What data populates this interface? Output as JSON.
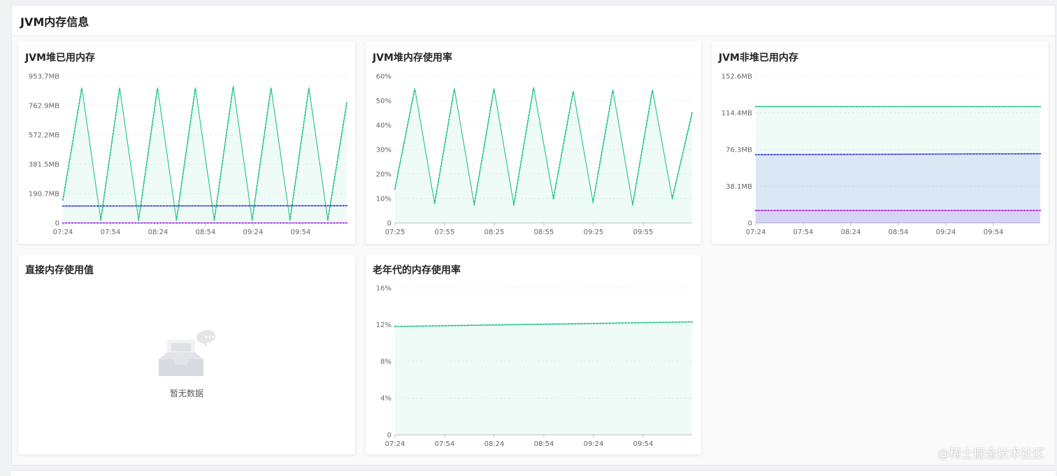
{
  "section": {
    "title": "JVM内存信息"
  },
  "colors": {
    "green": "#1fc486",
    "blue": "#3b3ce8",
    "purple": "#a92ee8"
  },
  "cards": {
    "heap_used": {
      "title": "JVM堆已用内存",
      "chart_data": {
        "type": "line",
        "ytick_labels": [
          "0",
          "190.7MB",
          "381.5MB",
          "572.2MB",
          "762.9MB",
          "953.7MB"
        ],
        "ylim": [
          0,
          953.7
        ],
        "xtick_labels": [
          "07:24",
          "07:54",
          "08:24",
          "08:54",
          "09:24",
          "09:54"
        ],
        "series": [
          {
            "color": "green",
            "area": true,
            "values": [
              150,
              880,
              20,
              880,
              20,
              880,
              20,
              880,
              20,
              890,
              20,
              880,
              20,
              880,
              20,
              780
            ]
          },
          {
            "color": "blue",
            "values": [
              110,
              112
            ]
          },
          {
            "color": "purple",
            "values": [
              0,
              0
            ]
          }
        ]
      }
    },
    "heap_usage_rate": {
      "title": "JVM堆内存使用率",
      "chart_data": {
        "type": "line",
        "ytick_labels": [
          "0",
          "10%",
          "20%",
          "30%",
          "40%",
          "50%",
          "60%"
        ],
        "ylim": [
          0,
          60
        ],
        "xtick_labels": [
          "07:25",
          "07:55",
          "08:25",
          "08:55",
          "09:25",
          "09:55"
        ],
        "series": [
          {
            "color": "green",
            "area": true,
            "values": [
              14,
              55,
              8,
              55,
              7.5,
              55,
              7.5,
              55.5,
              10,
              54,
              8.5,
              54.5,
              7.5,
              54.5,
              10,
              45
            ]
          }
        ]
      }
    },
    "nonheap_used": {
      "title": "JVM非堆已用内存",
      "chart_data": {
        "type": "line",
        "ytick_labels": [
          "0",
          "38.1MB",
          "76.3MB",
          "114.4MB",
          "152.6MB"
        ],
        "ylim": [
          0,
          152.6
        ],
        "xtick_labels": [
          "07:24",
          "07:54",
          "08:24",
          "08:54",
          "09:24",
          "09:54"
        ],
        "series": [
          {
            "color": "green",
            "area": true,
            "values": [
              121,
              121
            ]
          },
          {
            "color": "blue",
            "area": true,
            "values": [
              71,
              72
            ]
          },
          {
            "color": "purple",
            "area": true,
            "values": [
              13,
              13
            ]
          }
        ]
      }
    },
    "direct_memory": {
      "title": "直接内存使用值",
      "empty_text": "暂无数据"
    },
    "old_gen_rate": {
      "title": "老年代的内存使用率",
      "chart_data": {
        "type": "line",
        "ytick_labels": [
          "0",
          "4%",
          "8%",
          "12%",
          "16%"
        ],
        "ylim": [
          0,
          16
        ],
        "xtick_labels": [
          "07:24",
          "07:54",
          "08:24",
          "08:54",
          "09:24",
          "09:54"
        ],
        "series": [
          {
            "color": "green",
            "area": true,
            "values": [
              11.8,
              12.3
            ]
          }
        ]
      }
    }
  },
  "watermark": "@稀土掘金技术社区"
}
